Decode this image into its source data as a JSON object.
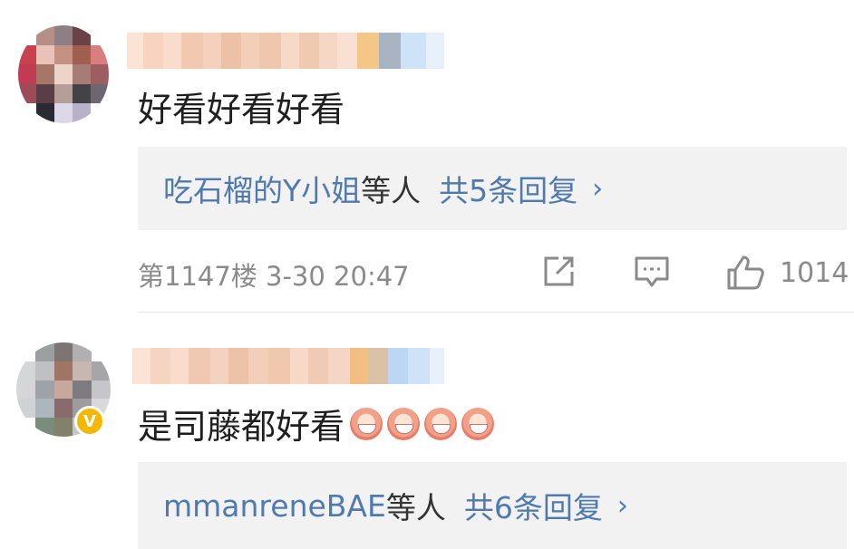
{
  "comments": [
    {
      "text": "好看好看好看",
      "reply": {
        "user": "吃石榴的Y小姐",
        "suffix": "等人",
        "count": "共5条回复",
        "chevron": "›"
      },
      "meta": "第1147楼 3-30 20:47",
      "likes": "1014"
    },
    {
      "text": "是司藤都好看",
      "emoji_count": 4,
      "verified_mark": "V",
      "reply": {
        "user": "mmanreneBAE",
        "suffix": "等人",
        "count": "共6条回复",
        "chevron": "›"
      }
    }
  ],
  "icons": [
    "share-icon",
    "comment-icon",
    "like-icon",
    "verified-badge-icon",
    "chevron-right-icon"
  ],
  "colors": {
    "link": "#4f7ab0",
    "meta": "#8a8a8a",
    "reply_bg": "#f2f2f2",
    "verified": "#f5b800"
  }
}
